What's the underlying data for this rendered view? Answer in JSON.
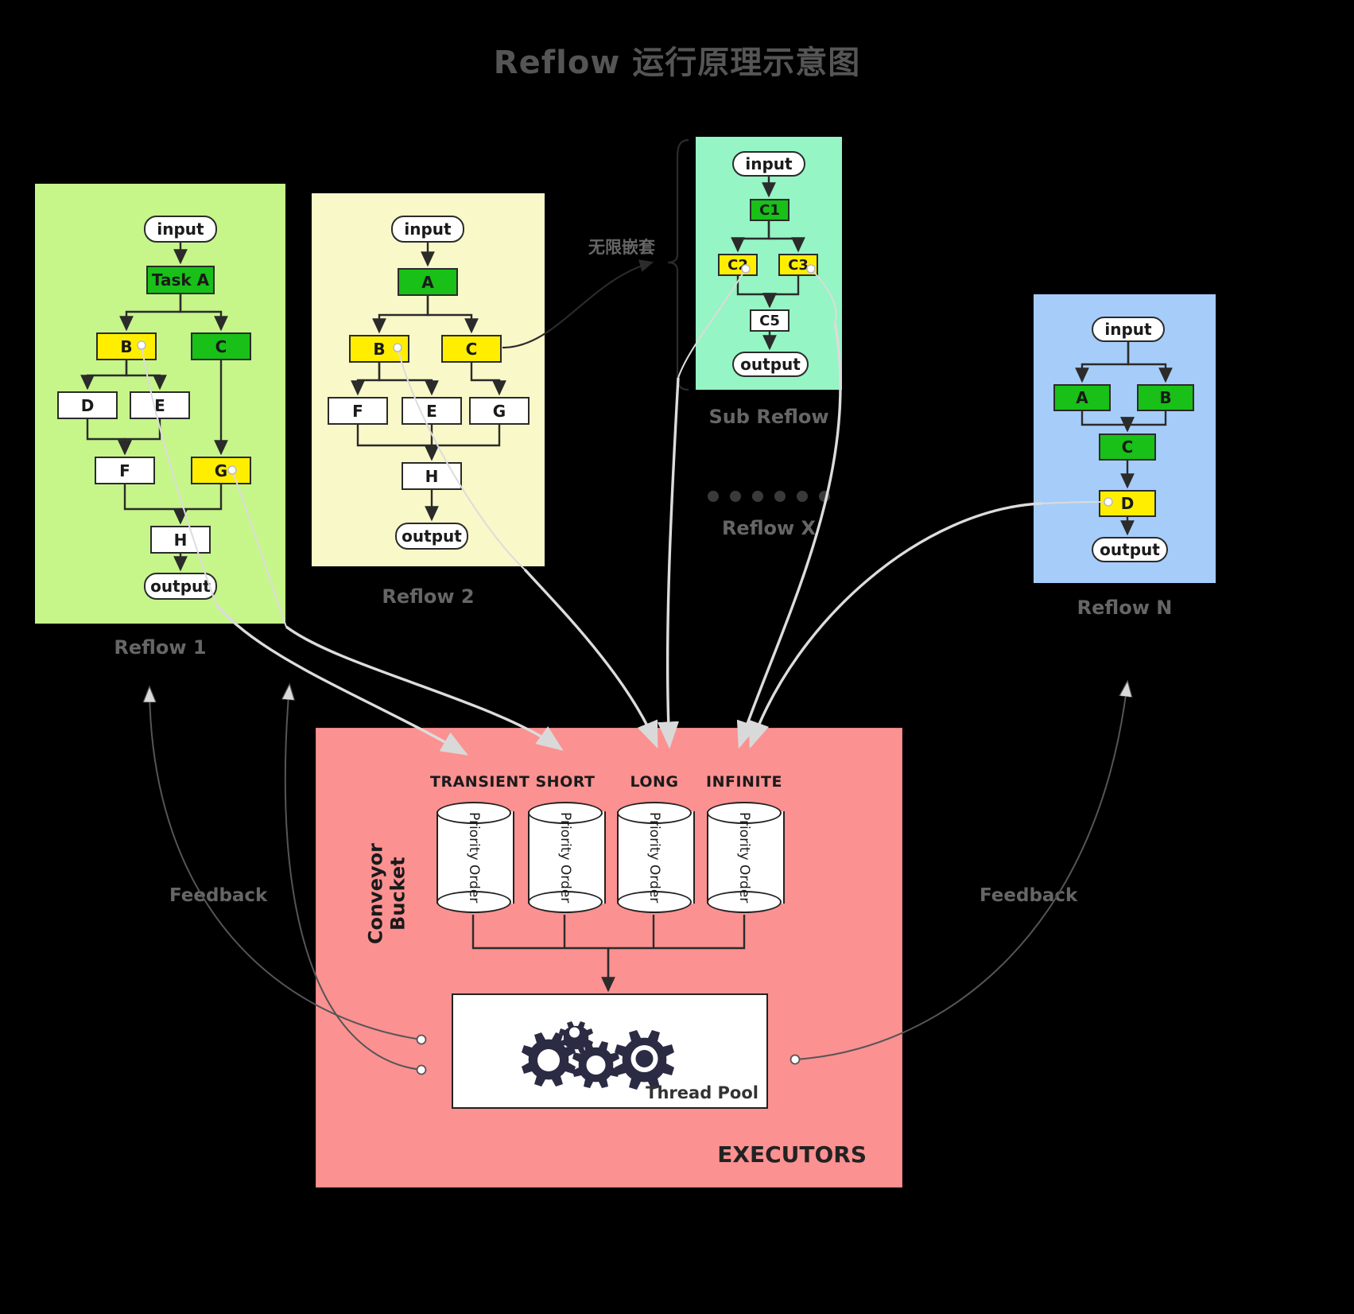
{
  "title": "Reflow 运行原理示意图",
  "nested_label": "无限嵌套",
  "reflows": [
    {
      "id": "reflow1",
      "label": "Reflow 1",
      "color": "#c6f58a",
      "nodes": [
        {
          "name": "input",
          "type": "terminal"
        },
        {
          "name": "Task A",
          "type": "green"
        },
        {
          "name": "B",
          "type": "yellow"
        },
        {
          "name": "C",
          "type": "green"
        },
        {
          "name": "D",
          "type": "white"
        },
        {
          "name": "E",
          "type": "white"
        },
        {
          "name": "F",
          "type": "white"
        },
        {
          "name": "G",
          "type": "yellow"
        },
        {
          "name": "H",
          "type": "white"
        },
        {
          "name": "output",
          "type": "terminal"
        }
      ]
    },
    {
      "id": "reflow2",
      "label": "Reflow 2",
      "color": "#f9f8c8",
      "nodes": [
        {
          "name": "input",
          "type": "terminal"
        },
        {
          "name": "A",
          "type": "green"
        },
        {
          "name": "B",
          "type": "yellow"
        },
        {
          "name": "C",
          "type": "yellow"
        },
        {
          "name": "F",
          "type": "white"
        },
        {
          "name": "E",
          "type": "white"
        },
        {
          "name": "G",
          "type": "white"
        },
        {
          "name": "H",
          "type": "white"
        },
        {
          "name": "output",
          "type": "terminal"
        }
      ]
    },
    {
      "id": "subreflow",
      "label": "Sub Reflow",
      "color": "#95f5c4",
      "nodes": [
        {
          "name": "input",
          "type": "terminal"
        },
        {
          "name": "C1",
          "type": "green"
        },
        {
          "name": "C2",
          "type": "yellow"
        },
        {
          "name": "C3",
          "type": "yellow"
        },
        {
          "name": "C5",
          "type": "white"
        },
        {
          "name": "output",
          "type": "terminal"
        }
      ]
    },
    {
      "id": "reflowx",
      "label": "Reflow X",
      "dots": 6
    },
    {
      "id": "reflown",
      "label": "Reflow N",
      "color": "#a6cdf9",
      "nodes": [
        {
          "name": "input",
          "type": "terminal"
        },
        {
          "name": "A",
          "type": "green"
        },
        {
          "name": "B",
          "type": "green"
        },
        {
          "name": "C",
          "type": "green"
        },
        {
          "name": "D",
          "type": "yellow"
        },
        {
          "name": "output",
          "type": "terminal"
        }
      ]
    }
  ],
  "executors": {
    "title": "EXECUTORS",
    "bucket_label_line1": "Conveyor",
    "bucket_label_line2": "Bucket",
    "queues": [
      {
        "name": "TRANSIENT",
        "order": "Priority Order"
      },
      {
        "name": "SHORT",
        "order": "Priority Order"
      },
      {
        "name": "LONG",
        "order": "Priority Order"
      },
      {
        "name": "INFINITE",
        "order": "Priority Order"
      }
    ],
    "thread_pool_label": "Thread Pool",
    "background": "#fb9191"
  },
  "feedback": {
    "left": "Feedback",
    "right": "Feedback"
  },
  "colors": {
    "green": "#18c018",
    "yellow": "#ffee00",
    "white": "#ffffff",
    "stroke": "#2b2b2b",
    "label": "#666666",
    "title": "#555555"
  }
}
